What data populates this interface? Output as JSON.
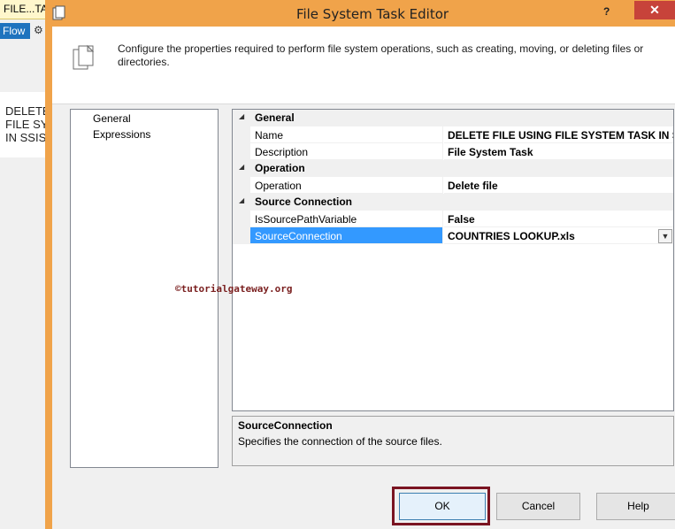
{
  "background_app": {
    "tab_label": "FILE...TA",
    "flow_label": "Flow",
    "note_lines": [
      "DELETE",
      "FILE SY",
      "IN SSIS"
    ]
  },
  "window": {
    "title": "File System Task Editor",
    "help_glyph": "?",
    "close_glyph": "✕"
  },
  "header": {
    "description": "Configure the properties required to perform file system operations, such as creating, moving, or deleting files or directories."
  },
  "nav": {
    "items": [
      "General",
      "Expressions"
    ]
  },
  "properties": {
    "categories": [
      {
        "name": "General",
        "rows": [
          {
            "name": "Name",
            "value": "DELETE FILE USING FILE SYSTEM TASK IN SSIS"
          },
          {
            "name": "Description",
            "value": "File System Task"
          }
        ]
      },
      {
        "name": "Operation",
        "rows": [
          {
            "name": "Operation",
            "value": "Delete file"
          }
        ]
      },
      {
        "name": "Source Connection",
        "rows": [
          {
            "name": "IsSourcePathVariable",
            "value": "False"
          },
          {
            "name": "SourceConnection",
            "value": "COUNTRIES LOOKUP.xls"
          }
        ]
      }
    ],
    "selected_row": "SourceConnection"
  },
  "description_panel": {
    "title": "SourceConnection",
    "text": "Specifies the connection of the source files."
  },
  "watermark": "©tutorialgateway.org",
  "buttons": {
    "ok": "OK",
    "cancel": "Cancel",
    "help": "Help"
  },
  "colors": {
    "title_bar": "#f0a34a",
    "close_button": "#c7433a",
    "selection": "#3399ff",
    "highlight_box": "#7a1421"
  }
}
